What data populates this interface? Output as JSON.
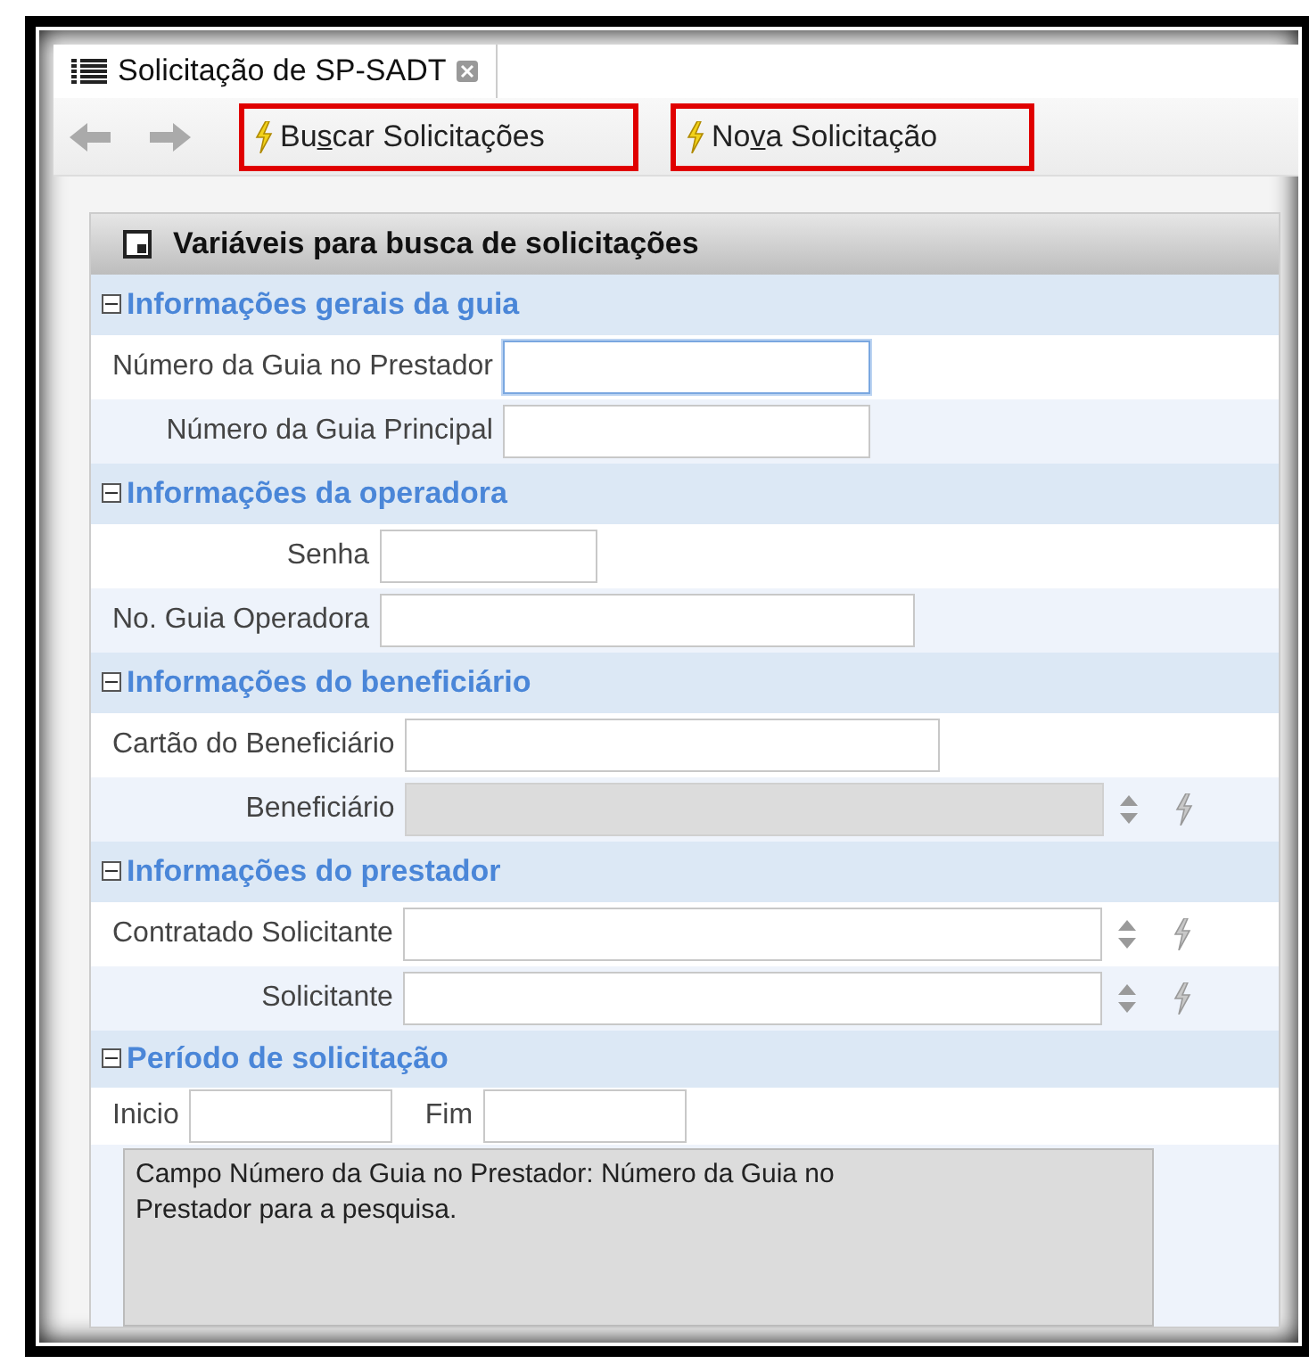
{
  "tab": {
    "title": "Solicitação de SP-SADT",
    "selected": true
  },
  "toolbar": {
    "buttons": [
      {
        "parts": [
          "Bu",
          "s",
          "car Solicitações"
        ]
      },
      {
        "parts": [
          "No",
          "v",
          "a Solicitação"
        ]
      }
    ]
  },
  "panel": {
    "title": "Variáveis para busca de solicitações",
    "sections": [
      {
        "title": "Informações gerais da guia",
        "expanded": true,
        "fields": [
          {
            "label": "Número da Guia no Prestador",
            "kind": "medium",
            "focused": true,
            "disabled": false
          },
          {
            "label": "Número da Guia Principal",
            "kind": "medium",
            "focused": false,
            "disabled": false
          }
        ]
      },
      {
        "title": "Informações da operadora",
        "expanded": true,
        "fields": [
          {
            "label": "Senha",
            "kind": "small",
            "focused": false,
            "disabled": false
          },
          {
            "label": "No. Guia Operadora",
            "kind": "large",
            "focused": false,
            "disabled": false
          }
        ]
      },
      {
        "title": "Informações do beneficiário",
        "expanded": true,
        "fields": [
          {
            "label": "Cartão do Beneficiário",
            "kind": "large",
            "focused": false,
            "disabled": false
          },
          {
            "label": "Beneficiário",
            "kind": "lookup",
            "focused": false,
            "disabled": true
          }
        ]
      },
      {
        "title": "Informações do prestador",
        "expanded": true,
        "fields": [
          {
            "label": "Contratado Solicitante",
            "kind": "lookup",
            "focused": false,
            "disabled": false
          },
          {
            "label": "Solicitante",
            "kind": "lookup",
            "focused": false,
            "disabled": false
          }
        ]
      }
    ],
    "period": {
      "title": "Período de solicitação",
      "expanded": true,
      "start_label": "Inicio",
      "end_label": "Fim"
    },
    "help_text": "Campo Número da Guia no Prestador: Número da Guia no Prestador para a pesquisa."
  }
}
